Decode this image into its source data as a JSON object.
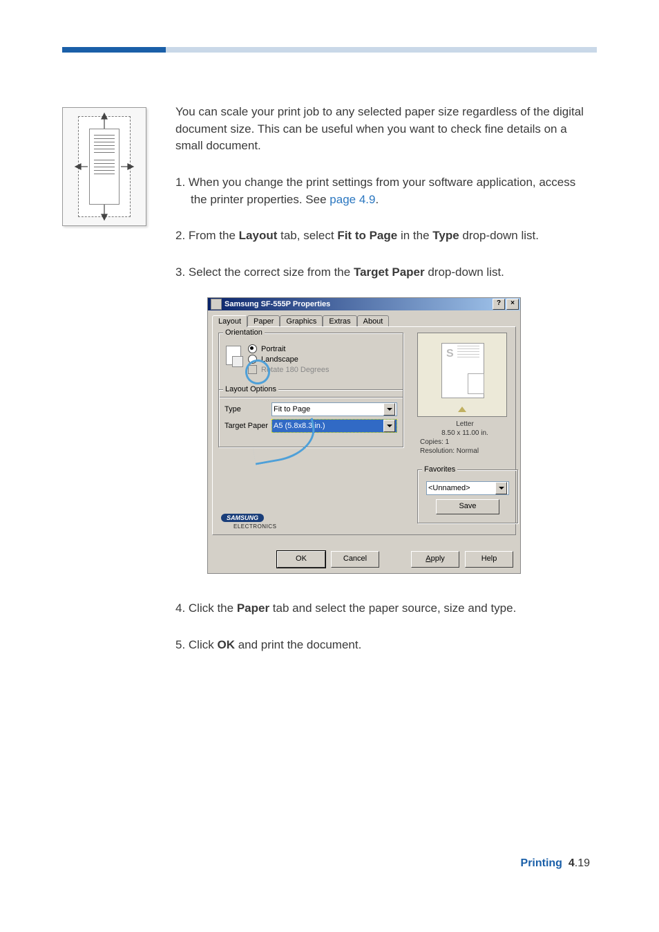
{
  "intro": "You can scale your print job to any selected paper size regardless of the digital document size. This can be useful when you want to check fine details on a small document.",
  "steps": {
    "s1a": "When you change the print settings from your software application, access the printer properties. See ",
    "s1_link": "page 4.9",
    "s1b": ".",
    "s2a": "From the ",
    "s2_b1": "Layout",
    "s2b": " tab, select ",
    "s2_b2": "Fit to Page",
    "s2c": " in the ",
    "s2_b3": "Type",
    "s2d": " drop-down list.",
    "s3a": "Select the correct size from the ",
    "s3_b1": "Target Paper",
    "s3b": " drop-down list.",
    "s4a": "Click the ",
    "s4_b1": "Paper",
    "s4b": " tab and select the paper source, size and type.",
    "s5a": "Click ",
    "s5_b1": "OK",
    "s5b": " and print the document."
  },
  "dialog": {
    "title": "Samsung SF-555P Properties",
    "tabs": [
      "Layout",
      "Paper",
      "Graphics",
      "Extras",
      "About"
    ],
    "orientation": {
      "legend": "Orientation",
      "portrait": "Portrait",
      "landscape": "Landscape",
      "rotate": "Rotate 180 Degrees"
    },
    "layout_options": {
      "legend": "Layout Options",
      "type_label": "Type",
      "type_value": "Fit to Page",
      "target_label": "Target Paper",
      "target_value": "A5 (5.8x8.3 in.)"
    },
    "preview": {
      "paper_name": "Letter",
      "paper_dim": "8.50 x 11.00 in.",
      "copies": "Copies: 1",
      "resolution": "Resolution: Normal"
    },
    "favorites": {
      "legend": "Favorites",
      "value": "<Unnamed>",
      "save": "Save"
    },
    "brand": {
      "name": "SAMSUNG",
      "sub": "ELECTRONICS"
    },
    "buttons": {
      "ok": "OK",
      "cancel": "Cancel",
      "apply": "Apply",
      "help": "Help"
    },
    "titlebar_help": "?",
    "titlebar_close": "×"
  },
  "footer": {
    "label": "Printing",
    "chapter": "4",
    "page": ".19"
  }
}
